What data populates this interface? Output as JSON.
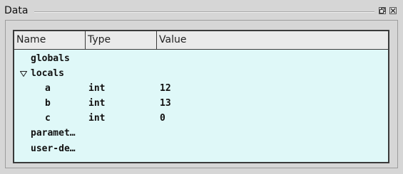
{
  "window": {
    "title": "Data"
  },
  "columns": {
    "name": "Name",
    "type": "Type",
    "value": "Value"
  },
  "tree": {
    "globals": "globals",
    "locals": "locals",
    "vars": [
      {
        "name": "a",
        "type": "int",
        "value": "12"
      },
      {
        "name": "b",
        "type": "int",
        "value": "13"
      },
      {
        "name": "c",
        "type": "int",
        "value": "0"
      }
    ],
    "parameters": "paramet…",
    "user_defined": "user-de…"
  },
  "icons": {
    "restore": "restore-icon",
    "close": "close-icon",
    "expand": "triangle-down-icon"
  },
  "colors": {
    "panel_background": "#dff8f8",
    "header_background": "#eaeaea",
    "window_background": "#d6d6d6"
  }
}
